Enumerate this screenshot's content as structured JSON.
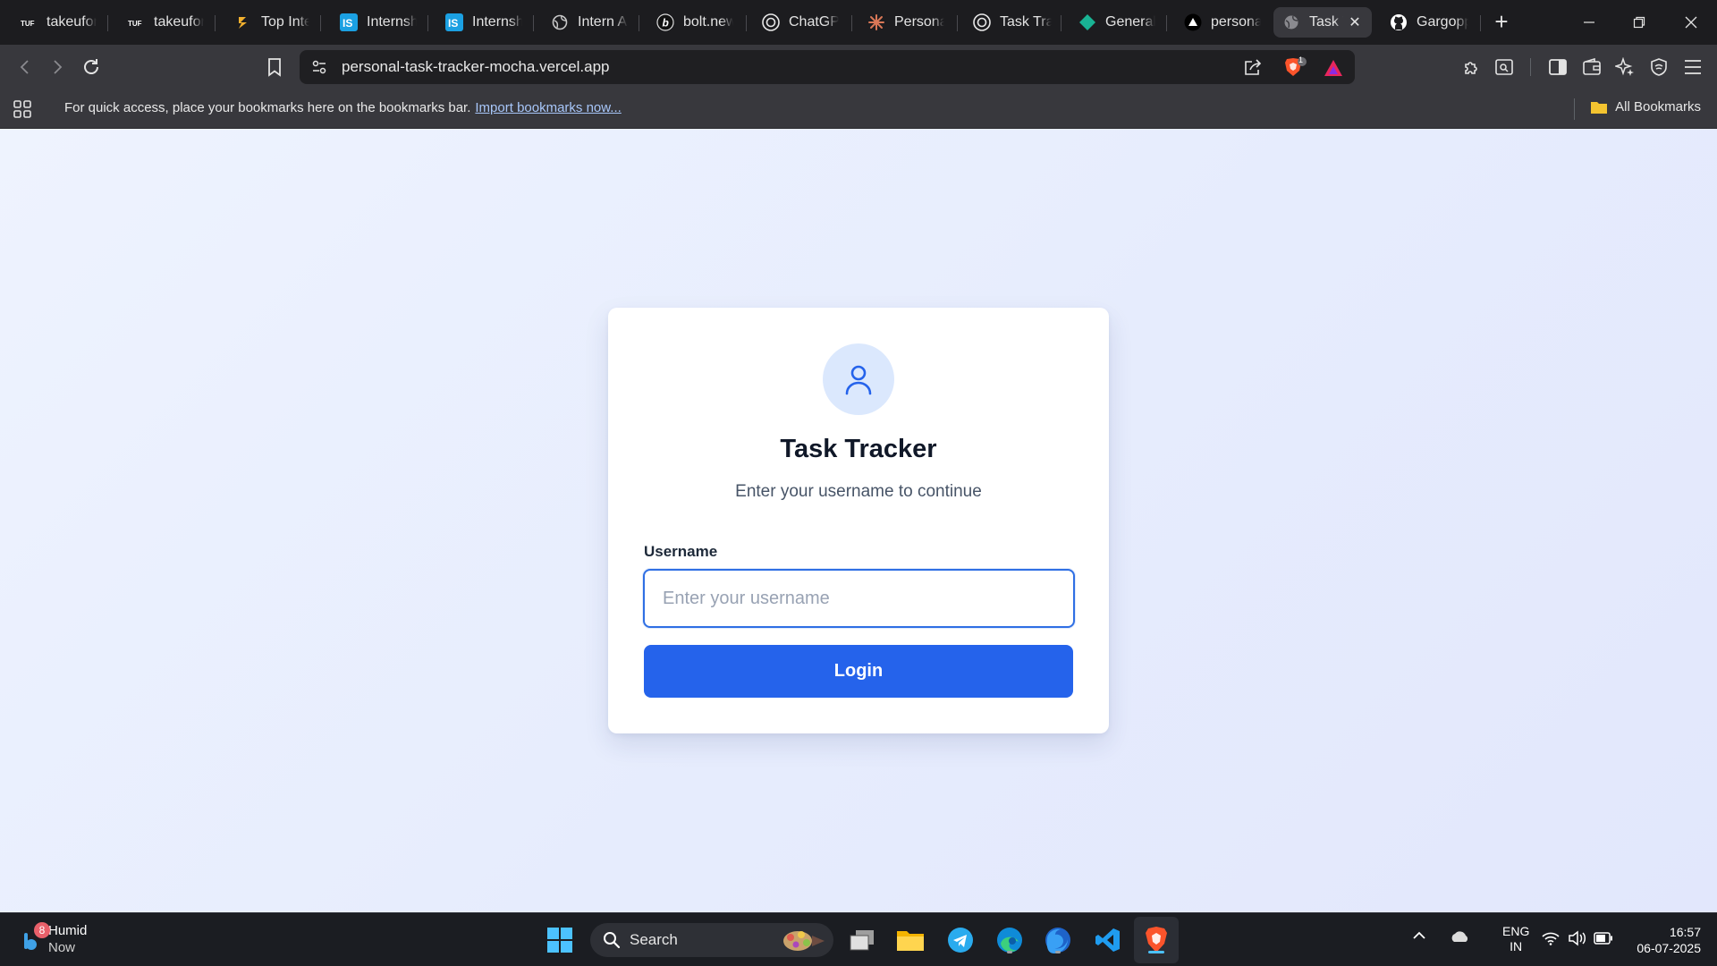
{
  "browser": {
    "tabs": [
      {
        "title": "takeuforward",
        "icon": "tuf-logo-icon"
      },
      {
        "title": "takeuforward",
        "icon": "tuf-logo-icon"
      },
      {
        "title": "Top Internships",
        "icon": "bolt-arrow-icon"
      },
      {
        "title": "Internshala",
        "icon": "internshala-icon"
      },
      {
        "title": "Internshala",
        "icon": "internshala-icon"
      },
      {
        "title": "Intern Assignment",
        "icon": "globe-icon"
      },
      {
        "title": "bolt.new",
        "icon": "bolt-icon"
      },
      {
        "title": "ChatGPT",
        "icon": "chatgpt-icon"
      },
      {
        "title": "Personal",
        "icon": "claude-icon"
      },
      {
        "title": "Task Tracker",
        "icon": "chatgpt-icon"
      },
      {
        "title": "General",
        "icon": "diamond-icon"
      },
      {
        "title": "personal-task-tracker",
        "icon": "vercel-icon"
      },
      {
        "title": "Task Tracker",
        "icon": "globe-icon",
        "active": true
      },
      {
        "title": "Gargopp",
        "icon": "github-icon"
      }
    ],
    "new_tab_label": "+",
    "url": "personal-task-tracker-mocha.vercel.app",
    "shields_count": "1",
    "bookmarks_bar": {
      "message": "For quick access, place your bookmarks here on the bookmarks bar.",
      "import_link": "Import bookmarks now...",
      "all_bookmarks": "All Bookmarks"
    }
  },
  "page": {
    "title": "Task Tracker",
    "subtitle": "Enter your username to continue",
    "username_label": "Username",
    "username_placeholder": "Enter your username",
    "username_value": "",
    "login_button": "Login"
  },
  "taskbar": {
    "weather_title": "Humid",
    "weather_sub": "Now",
    "weather_badge": "8",
    "search_label": "Search",
    "lang_top": "ENG",
    "lang_bottom": "IN",
    "time": "16:57",
    "date": "06-07-2025"
  },
  "colors": {
    "accent": "#2563eb",
    "active_tab": "#38383d",
    "page_bg": "#e6ecfd"
  }
}
